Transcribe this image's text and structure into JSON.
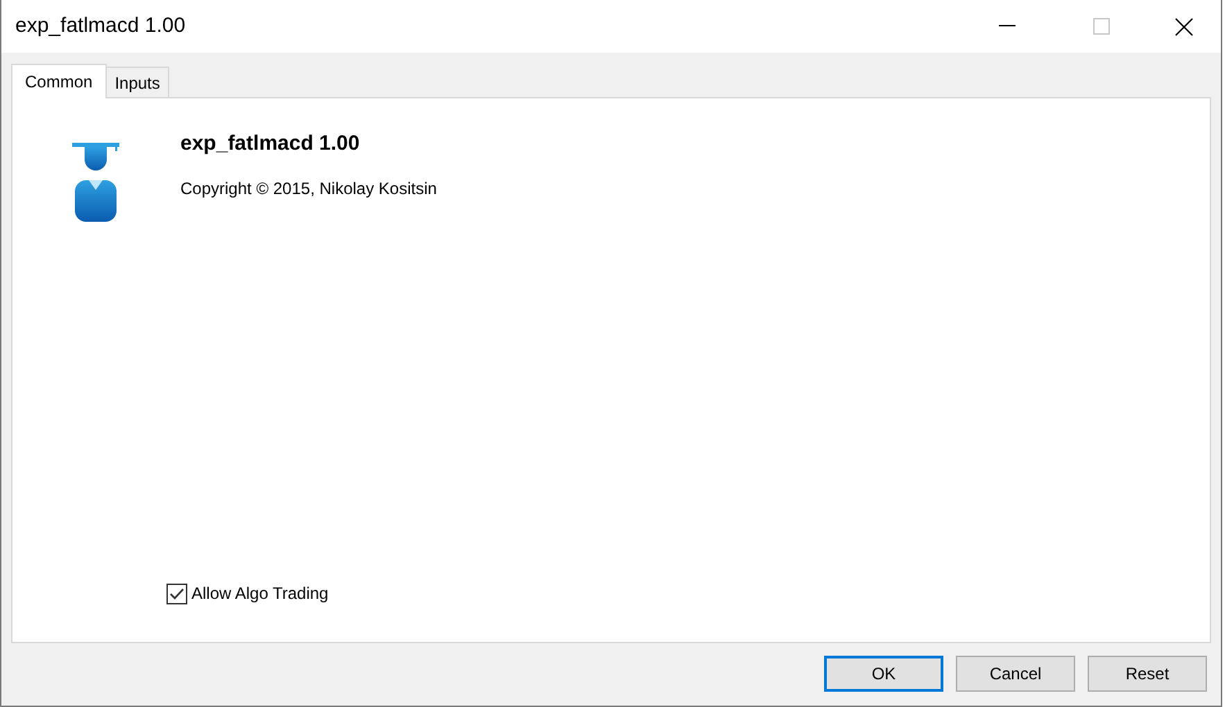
{
  "window": {
    "title": "exp_fatlmacd 1.00"
  },
  "tabs": [
    {
      "label": "Common",
      "selected": true
    },
    {
      "label": "Inputs",
      "selected": false
    }
  ],
  "program": {
    "name": "exp_fatlmacd 1.00",
    "copyright": "Copyright © 2015, Nikolay Kositsin"
  },
  "allow_algo_trading": {
    "label": "Allow Algo Trading",
    "checked": true
  },
  "buttons": [
    {
      "label": "OK",
      "default": true
    },
    {
      "label": "Cancel",
      "default": false
    },
    {
      "label": "Reset",
      "default": false
    }
  ]
}
